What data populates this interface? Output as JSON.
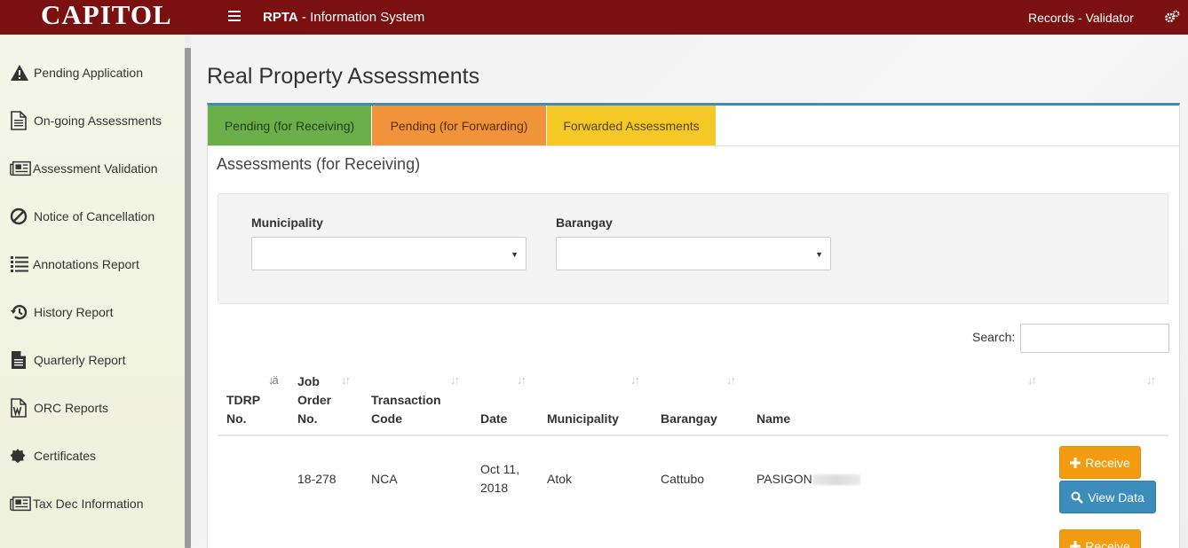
{
  "header": {
    "brand": "CAPITOL",
    "app_name_bold": "RPTA",
    "app_name_rest": " - Information System",
    "user_role": "Records - Validator"
  },
  "sidebar": {
    "items": [
      {
        "label": "Pending Application",
        "icon": "warning-icon"
      },
      {
        "label": "On-going Assessments",
        "icon": "document-icon"
      },
      {
        "label": "Assessment Validation",
        "icon": "newspaper-icon"
      },
      {
        "label": "Notice of Cancellation",
        "icon": "ban-icon"
      },
      {
        "label": "Annotations Report",
        "icon": "list-icon"
      },
      {
        "label": "History Report",
        "icon": "history-icon"
      },
      {
        "label": "Quarterly Report",
        "icon": "file-text-icon"
      },
      {
        "label": "ORC Reports",
        "icon": "word-file-icon"
      },
      {
        "label": "Certificates",
        "icon": "certificate-icon"
      },
      {
        "label": "Tax Dec Information",
        "icon": "newspaper-icon"
      }
    ]
  },
  "main": {
    "page_title": "Real Property Assessments",
    "tabs": [
      {
        "label": "Pending (for Receiving)"
      },
      {
        "label": "Pending (for Forwarding)"
      },
      {
        "label": "Forwarded Assessments"
      }
    ],
    "section_title": "Assessments (for Receiving)",
    "filters": {
      "municipality_label": "Municipality",
      "municipality_value": "",
      "barangay_label": "Barangay",
      "barangay_value": ""
    },
    "search": {
      "label": "Search:",
      "value": ""
    },
    "table": {
      "columns": [
        {
          "l1": "TDRP",
          "l2": "No.",
          "l3": ""
        },
        {
          "l1": "Job",
          "l2": "Order",
          "l3": "No."
        },
        {
          "l1": "Transaction",
          "l2": "Code",
          "l3": ""
        },
        {
          "l1": "Date",
          "l2": "",
          "l3": ""
        },
        {
          "l1": "Municipality",
          "l2": "",
          "l3": ""
        },
        {
          "l1": "Barangay",
          "l2": "",
          "l3": ""
        },
        {
          "l1": "Name",
          "l2": "",
          "l3": ""
        }
      ],
      "rows": [
        {
          "tdrp_no": "",
          "job_order_no": "18-278",
          "transaction_code": "NCA",
          "date_line1": "Oct 11,",
          "date_line2": "2018",
          "municipality": "Atok",
          "barangay": "Cattubo",
          "name": "PASIGON",
          "receive_label": "Receive",
          "view_label": "View Data"
        },
        {
          "receive_label": "Receive"
        }
      ]
    }
  },
  "colors": {
    "topbar": "#7a1010",
    "tab_green": "#6aaf4a",
    "tab_orange": "#f0933a",
    "tab_yellow": "#f4c925",
    "btn_receive": "#f39c12",
    "btn_view": "#3c8dbc",
    "panel_top_border": "#3c8dbc"
  }
}
